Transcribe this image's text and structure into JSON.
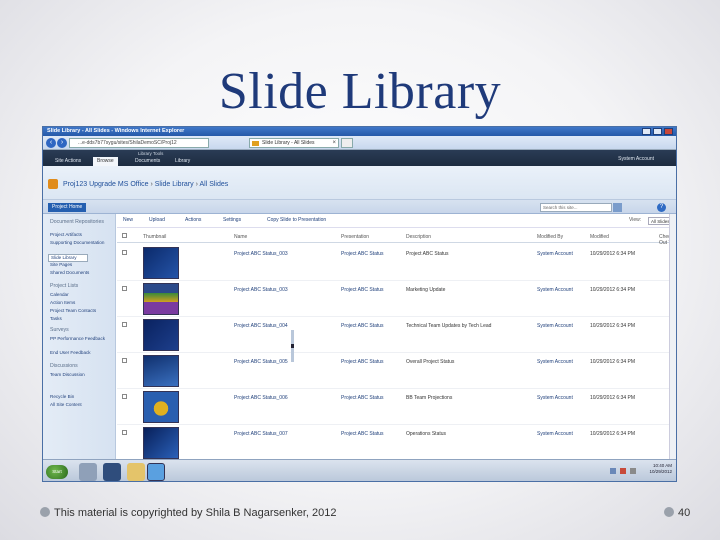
{
  "slide": {
    "title": "Slide Library",
    "footer": "This material is copyrighted by Shila B Nagarsenker, 2012",
    "page_number": "40"
  },
  "browser": {
    "window_title": "Slide Library - All Slides - Windows Internet Explorer",
    "address": "...e-dds7b77sygu/sites/ShilaDemoSC/Proj12",
    "tab_label": "Slide Library - All Slides"
  },
  "ribbon": {
    "tools_label": "Library Tools",
    "tabs": [
      "Site Actions",
      "Browse",
      "Documents",
      "Library"
    ],
    "account": "System Account"
  },
  "sharepoint": {
    "breadcrumb": [
      "Proj123 Upgrade MS Office",
      "Slide Library",
      "All Slides"
    ],
    "project_tab": "Project Home",
    "search_placeholder": "Search this site...",
    "help": "?"
  },
  "quicklaunch": {
    "items": [
      {
        "label": "Document Repositories",
        "kind": "head"
      },
      {
        "label": "Project Artifacts",
        "kind": "link"
      },
      {
        "label": "Supporting Documentation",
        "kind": "link"
      },
      {
        "label": "Slide Library",
        "kind": "selected"
      },
      {
        "label": "Site Pages",
        "kind": "link"
      },
      {
        "label": "Shared Documents",
        "kind": "link"
      },
      {
        "label": "Project Lists",
        "kind": "head"
      },
      {
        "label": "Calendar",
        "kind": "link"
      },
      {
        "label": "Action Items",
        "kind": "link"
      },
      {
        "label": "Project Team Contacts",
        "kind": "link"
      },
      {
        "label": "Tasks",
        "kind": "link"
      },
      {
        "label": "Surveys",
        "kind": "head"
      },
      {
        "label": "PP Performance Feedback",
        "kind": "link"
      },
      {
        "label": "End User Feedback",
        "kind": "link"
      },
      {
        "label": "Discussions",
        "kind": "head"
      },
      {
        "label": "Team Discussion",
        "kind": "link"
      },
      {
        "label": "Recycle Bin",
        "kind": "link"
      },
      {
        "label": "All Site Content",
        "kind": "link"
      }
    ]
  },
  "toolbar": {
    "items": [
      "New",
      "Upload",
      "Actions",
      "Settings",
      "Copy Slide to Presentation"
    ],
    "view_label": "View:",
    "view_value": "All Slides"
  },
  "table": {
    "headers": [
      "Thumbnail",
      "Name",
      "Presentation",
      "Description",
      "Modified By",
      "Modified",
      "Checked Out To"
    ],
    "rows": [
      {
        "name": "Project ABC Status_003",
        "presentation": "Project ABC Status",
        "description": "Project ABC Status",
        "modified_by": "System Account",
        "modified": "10/29/2012 6:34 PM"
      },
      {
        "name": "Project ABC Status_003",
        "presentation": "Project ABC Status",
        "description": "Marketing Update",
        "modified_by": "System Account",
        "modified": "10/29/2012 6:34 PM"
      },
      {
        "name": "Project ABC Status_004",
        "presentation": "Project ABC Status",
        "description": "Technical Team Updates by Tech Lead",
        "modified_by": "System Account",
        "modified": "10/29/2012 6:34 PM"
      },
      {
        "name": "Project ABC Status_005",
        "presentation": "Project ABC Status",
        "description": "Overall Project Status",
        "modified_by": "System Account",
        "modified": "10/29/2012 6:34 PM"
      },
      {
        "name": "Project ABC Status_006",
        "presentation": "Project ABC Status",
        "description": "BB Team Projections",
        "modified_by": "System Account",
        "modified": "10/29/2012 6:34 PM"
      },
      {
        "name": "Project ABC Status_007",
        "presentation": "Project ABC Status",
        "description": "Operations Status",
        "modified_by": "System Account",
        "modified": "10/29/2012 6:34 PM"
      }
    ]
  },
  "taskbar": {
    "start": "Start",
    "time": "10:40 AM",
    "date": "10/29/2012"
  },
  "colors": {
    "title": "#1f3a7a",
    "ribbon": "#2a3c55",
    "link": "#1f3f7a",
    "accent": "#245fb0"
  }
}
